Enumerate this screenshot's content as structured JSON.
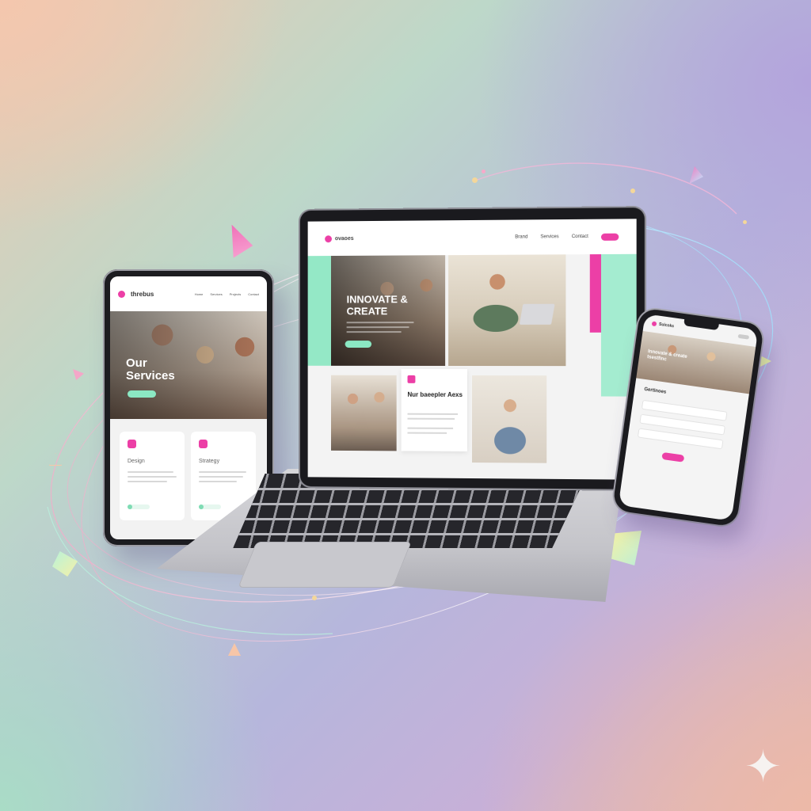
{
  "tablet": {
    "brand": "threbus",
    "nav_items": [
      "Home",
      "Services",
      "Projects",
      "Contact"
    ],
    "hero_title": "Our Services",
    "cards": [
      {
        "title": "Design"
      },
      {
        "title": "Strategy"
      }
    ]
  },
  "laptop": {
    "brand": "ovaoes",
    "nav_items": [
      "Brand",
      "Services",
      "Contact"
    ],
    "hero_title": "INNOVATE & CREATE",
    "feature_title": "Nur baeepler Aexs"
  },
  "phone": {
    "brand": "Suicoks",
    "hero_title": "Innovate & create tsestfinc",
    "form_title": "Gertinoes"
  },
  "colors": {
    "accent_pink": "#ec3fa6",
    "accent_mint": "#94e8c6"
  }
}
